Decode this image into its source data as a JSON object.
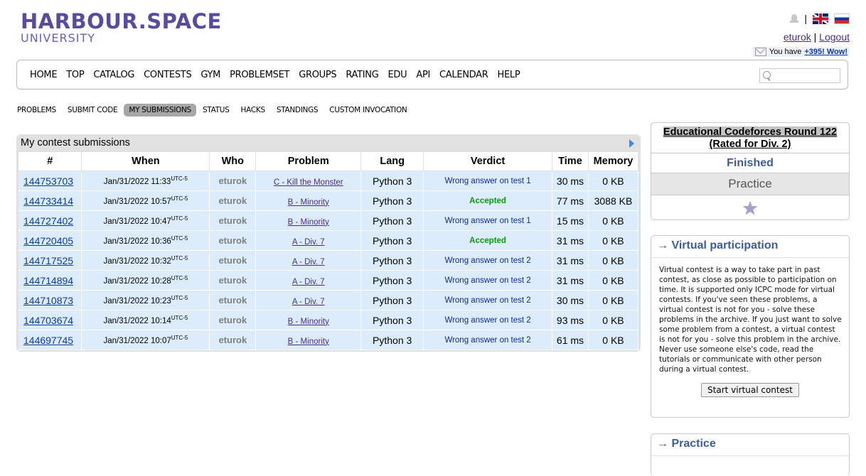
{
  "header": {
    "logo_main_1": "HARBOUR",
    "logo_dot": ".",
    "logo_main_2": "SPACE",
    "logo_sub": "UNIVERSITY",
    "separator": "|",
    "username": "eturok",
    "user_sep": "|",
    "logout": "Logout",
    "msg_prefix": "You have ",
    "msg_link": "+395! Wow!"
  },
  "menu": {
    "items": [
      "HOME",
      "TOP",
      "CATALOG",
      "CONTESTS",
      "GYM",
      "PROBLEMSET",
      "GROUPS",
      "RATING",
      "EDU",
      "API",
      "CALENDAR",
      "HELP"
    ]
  },
  "second_nav": {
    "items": [
      "PROBLEMS",
      "SUBMIT CODE",
      "MY SUBMISSIONS",
      "STATUS",
      "HACKS",
      "STANDINGS",
      "CUSTOM INVOCATION"
    ],
    "active": "MY SUBMISSIONS"
  },
  "submissions": {
    "title": "My contest submissions",
    "columns": [
      "#",
      "When",
      "Who",
      "Problem",
      "Lang",
      "Verdict",
      "Time",
      "Memory"
    ],
    "utc_suffix": "UTC-5",
    "rows": [
      {
        "id": "144753703",
        "when": "Jan/31/2022 11:33",
        "who": "eturok",
        "problem": "C - Kill the Monster",
        "lang": "Python 3",
        "verdict": "Wrong answer on test 1",
        "accepted": false,
        "time": "30 ms",
        "memory": "0 KB"
      },
      {
        "id": "144733414",
        "when": "Jan/31/2022 10:57",
        "who": "eturok",
        "problem": "B - Minority",
        "lang": "Python 3",
        "verdict": "Accepted",
        "accepted": true,
        "time": "77 ms",
        "memory": "3088 KB"
      },
      {
        "id": "144727402",
        "when": "Jan/31/2022 10:47",
        "who": "eturok",
        "problem": "B - Minority",
        "lang": "Python 3",
        "verdict": "Wrong answer on test 1",
        "accepted": false,
        "time": "15 ms",
        "memory": "0 KB"
      },
      {
        "id": "144720405",
        "when": "Jan/31/2022 10:36",
        "who": "eturok",
        "problem": "A - Div. 7",
        "lang": "Python 3",
        "verdict": "Accepted",
        "accepted": true,
        "time": "31 ms",
        "memory": "0 KB"
      },
      {
        "id": "144717525",
        "when": "Jan/31/2022 10:32",
        "who": "eturok",
        "problem": "A - Div. 7",
        "lang": "Python 3",
        "verdict": "Wrong answer on test 2",
        "accepted": false,
        "time": "31 ms",
        "memory": "0 KB"
      },
      {
        "id": "144714894",
        "when": "Jan/31/2022 10:28",
        "who": "eturok",
        "problem": "A - Div. 7",
        "lang": "Python 3",
        "verdict": "Wrong answer on test 2",
        "accepted": false,
        "time": "31 ms",
        "memory": "0 KB"
      },
      {
        "id": "144710873",
        "when": "Jan/31/2022 10:23",
        "who": "eturok",
        "problem": "A - Div. 7",
        "lang": "Python 3",
        "verdict": "Wrong answer on test 2",
        "accepted": false,
        "time": "30 ms",
        "memory": "0 KB"
      },
      {
        "id": "144703674",
        "when": "Jan/31/2022 10:14",
        "who": "eturok",
        "problem": "B - Minority",
        "lang": "Python 3",
        "verdict": "Wrong answer on test 2",
        "accepted": false,
        "time": "93 ms",
        "memory": "0 KB"
      },
      {
        "id": "144697745",
        "when": "Jan/31/2022 10:07",
        "who": "eturok",
        "problem": "B - Minority",
        "lang": "Python 3",
        "verdict": "Wrong answer on test 2",
        "accepted": false,
        "time": "61 ms",
        "memory": "0 KB"
      }
    ]
  },
  "sidebar": {
    "contest_name": "Educational Codeforces Round 122",
    "contest_rated": "(Rated for Div. 2)",
    "status": "Finished",
    "practice": "Practice",
    "vp_title": "→ Virtual participation",
    "vp_text": "Virtual contest is a way to take part in past contest, as close as possible to participation on time. It is supported only ICPC mode for virtual contests. If you've seen these problems, a virtual contest is not for you - solve these problems in the archive. If you just want to solve some problem from a contest, a virtual contest is not for you - solve this problem in the archive. Never use someone else's code, read the tutorials or communicate with other person during a virtual contest.",
    "vp_button": "Start virtual contest",
    "practice_title": "→ Practice"
  },
  "colors": {
    "logo": "#5b4b9e",
    "link": "#0a3aa9",
    "row_bg": "#dcecfa",
    "accepted": "#0a9b0a",
    "wrong": "#0b2a9c",
    "sidebar_head": "#3e5c99"
  }
}
